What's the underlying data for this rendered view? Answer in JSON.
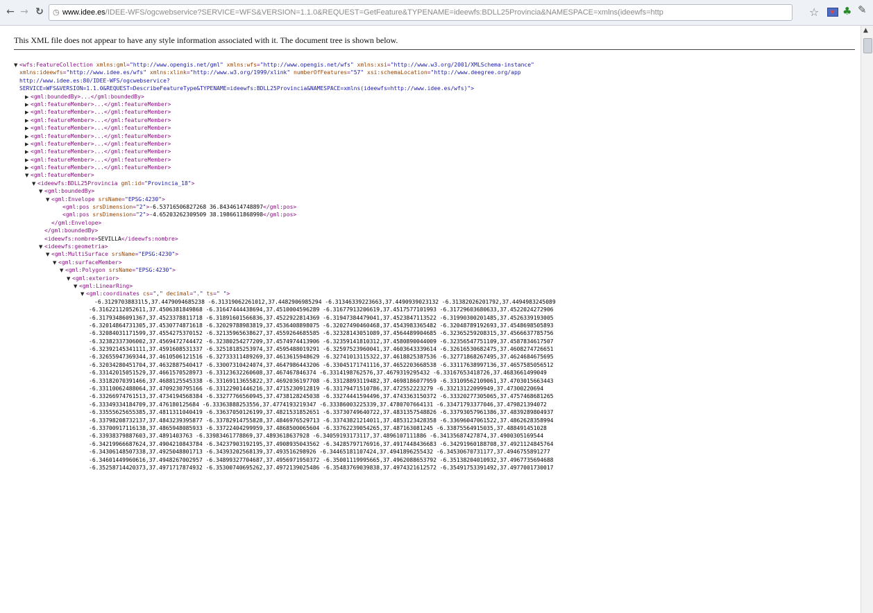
{
  "browser": {
    "url_host": "www.idee.es",
    "url_path": "/IDEE-WFS/ogcwebservice?SERVICE=WFS&VERSION=1.1.0&REQUEST=GetFeature&TYPENAME=ideewfs:BDLL25Provincia&NAMESPACE=xmlns(ideewfs=http"
  },
  "notice": "This XML file does not appear to have any style information associated with it. The document tree is shown below.",
  "root": {
    "l1_open": "<wfs:FeatureCollection",
    "l1_attrs": [
      {
        "n": "xmlns:gml",
        "v": "\"http://www.opengis.net/gml\""
      },
      {
        "n": "xmlns:wfs",
        "v": "\"http://www.opengis.net/wfs\""
      },
      {
        "n": "xmlns:xsi",
        "v": "\"http://www.w3.org/2001/XMLSchema-instance\""
      }
    ],
    "l2_attrs": [
      {
        "n": "xmlns:ideewfs",
        "v": "\"http://www.idee.es/wfs\""
      },
      {
        "n": "xmlns:xlink",
        "v": "\"http://www.w3.org/1999/xlink\""
      },
      {
        "n": "numberOfFeatures",
        "v": "\"57\""
      },
      {
        "n": "xsi:schemaLocation",
        "v": "\"http://www.deegree.org/app"
      }
    ],
    "l3_text": "http://www.idee.es:80/IDEE-WFS/ogcwebservice?",
    "l4_text": "SERVICE=WFS&VERSION=1.1.0&REQUEST=DescribeFeatureType&TYPENAME=ideewfs:BDLL25Provincia&NAMESPACE=xmlns(ideewfs=http://www.idee.es/wfs)\">"
  },
  "collapsed": {
    "boundedBy": "<gml:boundedBy>...</gml:boundedBy>",
    "featureMember": "<gml:featureMember>...</gml:featureMember>",
    "featureMember_count": 9
  },
  "expanded": {
    "featureMember_open": "<gml:featureMember>",
    "province_open": "<ideewfs:BDLL25Provincia",
    "province_attr_name": "gml:id",
    "province_attr_value": "\"Provincia_18\"",
    "province_close_bracket": ">",
    "boundedBy_open": "<gml:boundedBy>",
    "envelope_open": "<gml:Envelope",
    "envelope_attr_name": "srsName",
    "envelope_attr_value": "\"EPSG:4230\"",
    "pos_open": "<gml:pos",
    "pos_attr_name": "srsDimension",
    "pos_attr_value": "\"2\"",
    "pos1_value": "-6.53716506827268 36.8434614748897",
    "pos2_value": "-4.65203262309509 38.1986611868998",
    "pos_close": "</gml:pos>",
    "envelope_close": "</gml:Envelope>",
    "boundedBy_close": "</gml:boundedBy>",
    "nombre_open": "<ideewfs:nombre>",
    "nombre_value": "SEVILLA",
    "nombre_close": "</ideewfs:nombre>",
    "geometria_open": "<ideewfs:geometria>",
    "multisurface_open": "<gml:MultiSurface",
    "multisurface_attr_name": "srsName",
    "multisurface_attr_value": "\"EPSG:4230\"",
    "surfaceMember_open": "<gml:surfaceMember>",
    "polygon_open": "<gml:Polygon",
    "polygon_attr_name": "srsName",
    "polygon_attr_value": "\"EPSG:4230\"",
    "exterior_open": "<gml:exterior>",
    "linearring_open": "<gml:LinearRing>",
    "coordinates_open": "<gml:coordinates",
    "coord_attrs": [
      {
        "n": "cs",
        "v": "\",\""
      },
      {
        "n": "decimal",
        "v": "\".\""
      },
      {
        "n": "ts",
        "v": "\" \""
      }
    ],
    "coordinates_close_bracket": ">"
  },
  "coordinates_lines": [
    "-6.31297038831l5,37.4479094685238 -6.31319062261012,37.4482906985294 -6.31346339223663,37.4490939023132 -6.31382026201792,37.4494983245089",
    "-6.31622112052611,37.4506381849868 -6.31647444438694,37.4510004596289 -6.31677913206619,37.4517577101993 -6.31729603680633,37.4522024272906",
    "-6.31793486091367,37.4523378811718 -6.31891601566836,37.4522922814369 -6.31947384479041,37.4523847113522 -6.31990300201485,37.4526339193005",
    "-6.32014864731305,37.4530774871618 -6.32029788983819,37.4536408898075 -6.32027490460468,37.4543983365482 -6.32048789192693,37.4548698505893",
    "-6.32084031171599,37.4554275370152 -6.32135965638627,37.4559264685585 -6.32328143051089,37.4564489904685 -6.32365259208315,37.4566637785756",
    "-6.32382337306002,37.4569472744472 -6.32380254277209,37.4574974413906 -6.32359141810312,37.4580890044009 -6.32356547751109,37.4587834617507",
    "-6.32392145341111,37.4591608531337 -6.32518185253974,37.4595488019291 -6.32597523960041,37.4603643339614 -6.32616530682475,37.4608274726651",
    "-6.32655947369344,37.4610506121516 -6.32733311489269,37.4613615948629 -6.32741013115322,37.4618825387536 -6.32771868267495,37.4624684675695",
    "-6.32034280451704,37.4632887540417 -6.33007310424074,37.4647986443206 -6.33045171741116,37.4652203668538 -6.33117638997136,37.4657585056512",
    "-6.33142015051529,37.4661570528973 -6.33123632260608,37.467467846374 -6.3314198762576,37.4679319295432 -6.33167653418726,37.4683661499049",
    "-6.33182070391466,37.4688125545338 -6.33169113655822,37.4692036197708 -6.33128893119482,37.4698186077959 -6.33109562109061,37.4703015663443",
    "-6.33110062488064,37.4709230795166 -6.33122901446216,37.4715230912819 -6.33179471510786,37.472552223279 -6.33213122099949,37.47300220694",
    "-6.33266974761513,37.4734194568384 -6.33277766560945,37.4738128245038 -6.33274441594496,37.4743363150372 -6.33320277305065,37.4757468681265",
    "-6.33349334184709,37.476180125684 -6.33363888253556,37.4774193219347 -6.33386003225339,37.4780707664131 -6.33471793377046,37.479821394072",
    "-6.33555625655385,37.4811311040419 -6.33637050126199,37.4821531852651 -6.33730749640722,37.4831357548826 -6.33793057961386,37.4839289804937",
    "-6.33798208732137,37.4843239395877 -6.33782914755828,37.4846976529713 -6.33743821214011,37.4853123428358 -6.33696047061522,37.4862628358994",
    "-6.33700917116138,37.4865948085933 -6.33722404299959,37.4868500065604 -6.33762239054265,37.487163081245 -6.33875564915035,37.488491451028",
    "-6.33938379887603,37.4891403763 -6.33983461778869,37.4893618637928 -6.34059193173117,37.4896107111886 -6.34135687427874,37.4900305169544",
    "-6.34219966687624,37.4904210843784 -6.34237903192195,37.4908935043562 -6.34285797176916,37.4917448436683 -6.34291960188708,37.4921124845764",
    "-6.34306148507338,37.4925048801713 -6.34393202568139,37.493516298926 -6.34465181107424,37.4941896255432 -6.34530670731177,37.4946755891277",
    "-6.34601449960616,37.4948267002957 -6.34899327704687,37.4956971950372 -6.35001119995665,37.4962088653792 -6.35138204010932,37.4967735694688",
    "-6.35258714420373,37.4971717874932 -6.35300740695262,37.4972139025486 -6.35483769039838,37.4974321612572 -6.35491753391492,37.4977001730017"
  ]
}
